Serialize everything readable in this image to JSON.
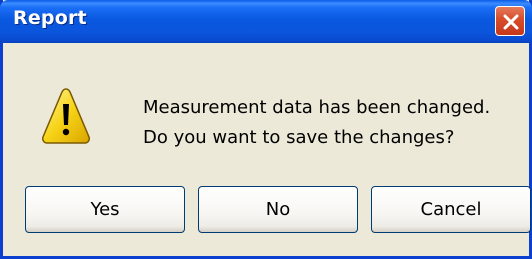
{
  "window": {
    "title": "Report",
    "close_icon": "close-icon"
  },
  "message": {
    "icon": "warning-icon",
    "line1": "Measurement data has been changed.",
    "line2": "Do you want to save the changes?"
  },
  "buttons": {
    "yes": "Yes",
    "no": "No",
    "cancel": "Cancel"
  },
  "colors": {
    "titlebar": "#0a58e0",
    "dialog_bg": "#ece9d8",
    "close_button": "#d84f2c",
    "warning": "#f7d317"
  }
}
